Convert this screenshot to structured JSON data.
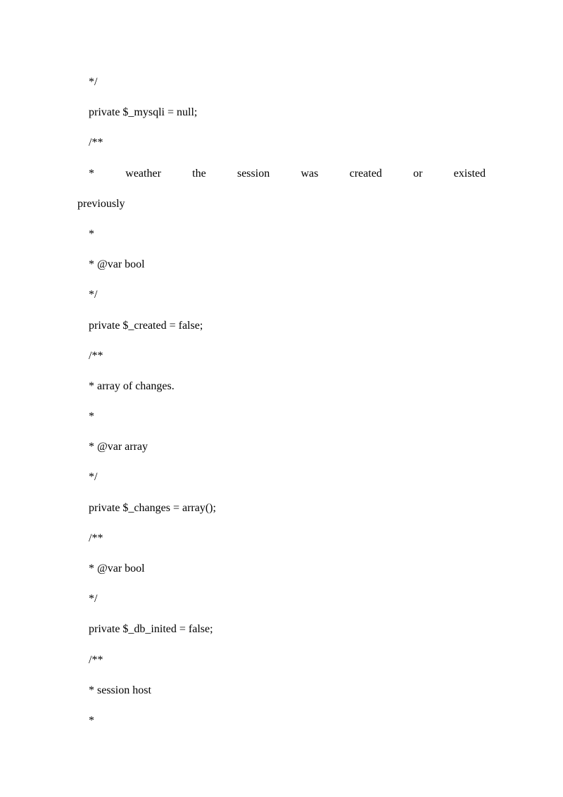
{
  "lines": {
    "l01": "*/",
    "l02": "private $_mysqli = null;",
    "l03": "/**",
    "l04": "*  weather  the  session  was  created  or  existed",
    "l05": "previously",
    "l06": "*",
    "l07": "* @var bool",
    "l08": "*/",
    "l09": "private $_created = false;",
    "l10": "/**",
    "l11": "* array of changes.",
    "l12": "*",
    "l13": "* @var array",
    "l14": "*/",
    "l15": "private $_changes = array();",
    "l16": "/**",
    "l17": "* @var bool",
    "l18": "*/",
    "l19": "private $_db_inited = false;",
    "l20": "/**",
    "l21": "* session host",
    "l22": "*"
  }
}
